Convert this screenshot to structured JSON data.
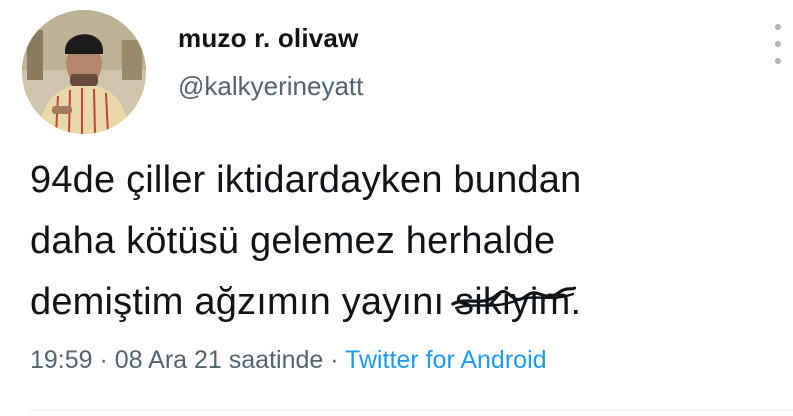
{
  "author": {
    "display_name": "muzo r. olivaw",
    "handle": "@kalkyerineyatt"
  },
  "tweet": {
    "line1": "94de çiller iktidardayken bundan",
    "line2": "daha kötüsü gelemez herhalde",
    "line3_before": "demiştim ağzımın yayını ",
    "line3_struck": "sikiyim",
    "line3_after": "."
  },
  "meta": {
    "time": "19:59",
    "separator1": " · ",
    "date": "08 Ara 21 saatinde",
    "separator2": " · ",
    "source": "Twitter for Android"
  },
  "icons": {
    "more": "more-vertical-icon",
    "avatar": "profile-avatar"
  },
  "colors": {
    "text": "#0f1419",
    "secondary": "#536471",
    "link": "#1d9bf0"
  }
}
